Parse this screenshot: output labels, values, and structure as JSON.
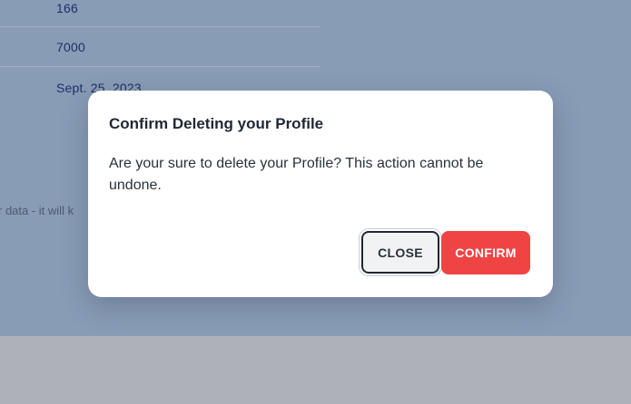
{
  "background": {
    "rows": [
      {
        "value": "166"
      },
      {
        "value": "7000"
      },
      {
        "value": "Sept. 25, 2023"
      }
    ],
    "note_fragment": "r data - it will k"
  },
  "modal": {
    "title": "Confirm Deleting your Profile",
    "message": "Are your sure to delete your Profile? This action cannot be undone.",
    "close_label": "CLOSE",
    "confirm_label": "CONFIRM"
  },
  "colors": {
    "overlay": "#889cb6",
    "confirm": "#ef4444",
    "text_dark": "#1f2733"
  }
}
